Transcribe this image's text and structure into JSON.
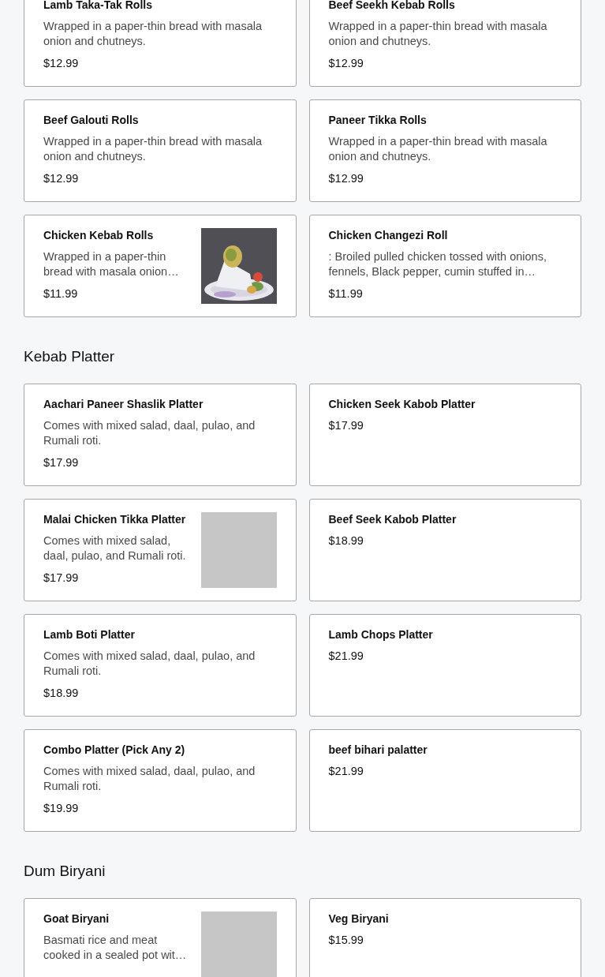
{
  "sections": [
    {
      "items": [
        {
          "name": "Lamb Taka-Tak Rolls",
          "description": "Wrapped in a paper-thin bread with masala onion and chutneys.",
          "price": "$12.99"
        },
        {
          "name": "Beef Seekh Kebab Rolls",
          "description": "Wrapped in a paper-thin bread with masala onion and chutneys.",
          "price": "$12.99"
        },
        {
          "name": "Beef Galouti Rolls",
          "description": "Wrapped in a paper-thin bread with masala onion and chutneys.",
          "price": "$12.99"
        },
        {
          "name": "Paneer Tikka Rolls",
          "description": "Wrapped in a paper-thin bread with masala onion and chutneys.",
          "price": "$12.99"
        },
        {
          "name": "Chicken Kebab Rolls",
          "description": "Wrapped in a paper-thin bread with masala onion…",
          "price": "$11.99",
          "kind": "picture"
        },
        {
          "name": "Chicken Changezi Roll",
          "description": ": Broiled pulled chicken tossed with onions, fennels, Black pepper, cumin stuffed in…",
          "price": "$11.99"
        }
      ]
    },
    {
      "title": "Kebab Platter",
      "items": [
        {
          "name": "Aachari Paneer Shaslik Platter",
          "description": "Comes with mixed salad, daal, pulao, and Rumali roti.",
          "price": "$17.99"
        },
        {
          "name": "Chicken Seek Kabob Platter",
          "price": "$17.99"
        },
        {
          "name": "Malai Chicken Tikka Platter",
          "description": "Comes with mixed salad, daal, pulao, and Rumali roti.",
          "price": "$17.99",
          "kind": "image-placeholder"
        },
        {
          "name": "Beef Seek Kabob Platter",
          "price": "$18.99"
        },
        {
          "name": "Lamb Boti Platter",
          "description": "Comes with mixed salad, daal, pulao, and Rumali roti.",
          "price": "$18.99"
        },
        {
          "name": "Lamb Chops Platter",
          "price": "$21.99"
        },
        {
          "name": "Combo Platter (Pick Any 2)",
          "description": "Comes with mixed salad, daal, pulao, and Rumali roti.",
          "price": "$19.99"
        },
        {
          "name": "beef bihari palatter",
          "price": "$21.99"
        }
      ]
    },
    {
      "title": "Dum Biryani",
      "items": [
        {
          "name": "Goat Biryani",
          "description": "Basmati rice and meat cooked in a sealed pot wit…",
          "kind": "image-placeholder"
        },
        {
          "name": "Veg Biryani",
          "price": "$15.99"
        }
      ]
    }
  ]
}
